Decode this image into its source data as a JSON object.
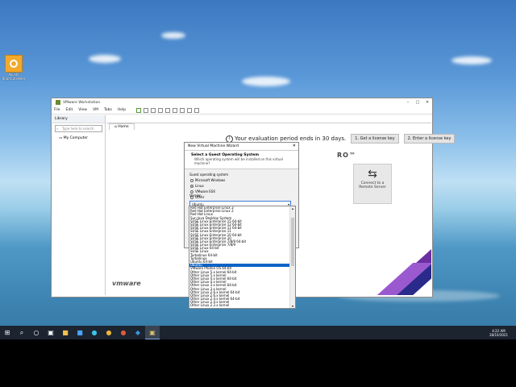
{
  "desktop": {
    "icon": {
      "name": "folder-icon",
      "label_line1": "Ayushi",
      "label_line2": "ShortcutsHere"
    }
  },
  "vmware": {
    "title": "VMware Workstation",
    "menu": [
      "File",
      "Edit",
      "View",
      "VM",
      "Tabs",
      "Help"
    ],
    "library": {
      "header": "Library",
      "search_placeholder": "Type here to search",
      "tree_item": "My Computer"
    },
    "tab": "Home",
    "eval_text": "Your evaluation period ends in 30 days.",
    "buttons": {
      "license": "1. Get a license key",
      "enter": "2. Enter a license key"
    },
    "pro": "RO™",
    "connect": {
      "line1": "Connect to a",
      "line2": "Remote Server"
    },
    "logo": "vmware"
  },
  "wizard": {
    "title": "New Virtual Machine Wizard",
    "heading": "Select a Guest Operating System",
    "subheading": "Which operating system will be installed on this virtual machine?",
    "group_label": "Guest operating system",
    "options": [
      {
        "label": "Microsoft Windows",
        "selected": false
      },
      {
        "label": "Linux",
        "selected": true
      },
      {
        "label": "VMware ESX",
        "selected": false
      },
      {
        "label": "Other",
        "selected": false
      }
    ],
    "version_label": "Version",
    "version_value": "Ubuntu",
    "buttons": [
      "Help",
      "< Back",
      "Next >",
      "Cancel"
    ]
  },
  "dropdown": {
    "items": [
      "Red Hat Enterprise Linux 3",
      "Red Hat Enterprise Linux 2",
      "Red Hat Linux",
      "Sun Java Desktop System",
      "SUSE Linux Enterprise 15 64-bit",
      "SUSE Linux Enterprise 12 64-bit",
      "SUSE Linux Enterprise 11 64-bit",
      "SUSE Linux Enterprise 11",
      "SUSE Linux Enterprise 10 64-bit",
      "SUSE Linux Enterprise 10",
      "SUSE Linux Enterprise 7/8/9 64-bit",
      "SUSE Linux Enterprise 7/8/9",
      "SUSE Linux 64-bit",
      "SUSE Linux",
      "Turbolinux 64-bit",
      "Turbolinux",
      "Ubuntu 64-bit",
      "Ubuntu",
      "VMware Photon OS 64-bit",
      "Other Linux 5.x kernel 64-bit",
      "Other Linux 5.x kernel",
      "Other Linux 4.x kernel 64-bit",
      "Other Linux 4.x kernel",
      "Other Linux 3.x kernel 64-bit",
      "Other Linux 3.x kernel",
      "Other Linux 2.6.x kernel 64-bit",
      "Other Linux 2.6.x kernel",
      "Other Linux 2.4.x kernel 64-bit",
      "Other Linux 2.4.x kernel",
      "Other Linux 2.2.x kernel"
    ],
    "selected_index": 17
  },
  "taskbar": {
    "time": "4:22 AM",
    "date": "28/10/2021"
  }
}
